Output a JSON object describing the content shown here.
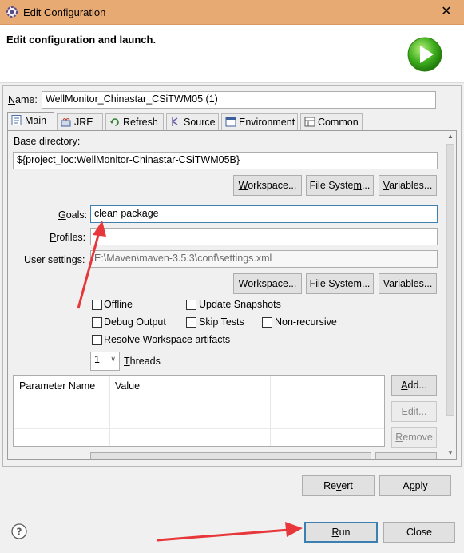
{
  "window": {
    "title": "Edit Configuration",
    "close_glyph": "✕"
  },
  "header": {
    "heading": "Edit configuration and launch."
  },
  "name": {
    "label": "Name:",
    "value": "WellMonitor_Chinastar_CSiTWM05 (1)"
  },
  "tabs": [
    {
      "label": "Main",
      "icon": "document-icon",
      "active": true
    },
    {
      "label": "JRE",
      "icon": "jre-icon"
    },
    {
      "label": "Refresh",
      "icon": "refresh-icon"
    },
    {
      "label": "Source",
      "icon": "source-icon"
    },
    {
      "label": "Environment",
      "icon": "environment-icon"
    },
    {
      "label": "Common",
      "icon": "common-icon"
    }
  ],
  "main": {
    "base_dir_label": "Base directory:",
    "base_dir_value": "${project_loc:WellMonitor-Chinastar-CSiTWM05B}",
    "buttons1": {
      "workspace": "Workspace...",
      "filesystem": "File System...",
      "variables": "Variables..."
    },
    "goals_label": "Goals:",
    "goals_value": "clean package",
    "profiles_label": "Profiles:",
    "profiles_value": "",
    "user_settings_label": "User settings:",
    "user_settings_value": "E:\\Maven\\maven-3.5.3\\conf\\settings.xml",
    "buttons2": {
      "workspace": "Workspace...",
      "filesystem": "File System...",
      "variables": "Variables..."
    },
    "checkboxes": {
      "offline": "Offline",
      "update_snapshots": "Update Snapshots",
      "debug_output": "Debug Output",
      "skip_tests": "Skip Tests",
      "non_recursive": "Non-recursive",
      "resolve_workspace": "Resolve Workspace artifacts"
    },
    "threads_value": "1",
    "threads_label": "Threads",
    "table": {
      "col1": "Parameter Name",
      "col2": "Value"
    },
    "table_buttons": {
      "add": "Add...",
      "edit": "Edit...",
      "remove": "Remove"
    }
  },
  "panel_buttons": {
    "revert": "Revert",
    "apply": "Apply"
  },
  "footer": {
    "run": "Run",
    "close": "Close",
    "help_glyph": "?"
  },
  "colors": {
    "titlebar": "#e8aa73",
    "accent": "#3c7fb1",
    "arrow": "#e8373a"
  }
}
